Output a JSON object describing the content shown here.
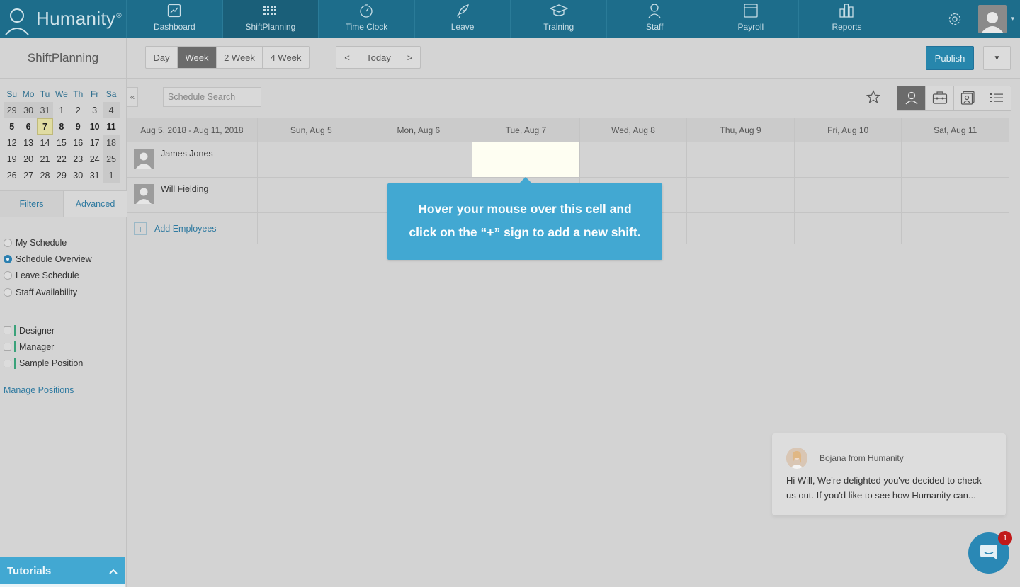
{
  "brand": {
    "name": "Humanity",
    "reg": "®"
  },
  "nav": [
    {
      "label": "Dashboard",
      "icon": "dashboard-icon"
    },
    {
      "label": "ShiftPlanning",
      "icon": "calendar-grid-icon"
    },
    {
      "label": "Time Clock",
      "icon": "stopwatch-icon"
    },
    {
      "label": "Leave",
      "icon": "rocket-icon"
    },
    {
      "label": "Training",
      "icon": "graduation-cap-icon"
    },
    {
      "label": "Staff",
      "icon": "person-icon"
    },
    {
      "label": "Payroll",
      "icon": "payroll-icon"
    },
    {
      "label": "Reports",
      "icon": "bar-chart-icon"
    }
  ],
  "toolbar": {
    "title": "ShiftPlanning",
    "ranges": [
      "Day",
      "Week",
      "2 Week",
      "4 Week"
    ],
    "active_range": "Week",
    "prev": "<",
    "today": "Today",
    "next": ">",
    "publish": "Publish"
  },
  "mini_calendar": {
    "headers": [
      "Su",
      "Mo",
      "Tu",
      "We",
      "Th",
      "Fr",
      "Sa"
    ],
    "weeks": [
      [
        "29",
        "30",
        "31",
        "1",
        "2",
        "3",
        "4"
      ],
      [
        "5",
        "6",
        "7",
        "8",
        "9",
        "10",
        "11"
      ],
      [
        "12",
        "13",
        "14",
        "15",
        "16",
        "17",
        "18"
      ],
      [
        "19",
        "20",
        "21",
        "22",
        "23",
        "24",
        "25"
      ],
      [
        "26",
        "27",
        "28",
        "29",
        "30",
        "31",
        "1"
      ]
    ],
    "today": "7"
  },
  "sidebar": {
    "tabs": [
      "Filters",
      "Advanced"
    ],
    "views": [
      "My Schedule",
      "Schedule Overview",
      "Leave Schedule",
      "Staff Availability"
    ],
    "selected_view": "Schedule Overview",
    "positions": [
      "Designer",
      "Manager",
      "Sample Position"
    ],
    "manage_positions": "Manage Positions",
    "tutorials": "Tutorials"
  },
  "schedule": {
    "search_placeholder": "Schedule Search",
    "range_label": "Aug 5, 2018 - Aug 11, 2018",
    "days": [
      "Sun, Aug 5",
      "Mon, Aug 6",
      "Tue, Aug 7",
      "Wed, Aug 8",
      "Thu, Aug 9",
      "Fri, Aug 10",
      "Sat, Aug 11"
    ],
    "employees": [
      "James Jones",
      "Will Fielding"
    ],
    "add_employees": "Add Employees"
  },
  "tooltip": {
    "line1": "Hover your mouse over this cell and",
    "line2": "click on the “+” sign to add a new shift."
  },
  "chat": {
    "from": "Bojana from Humanity",
    "line1": "Hi Will, We're delighted you've decided to check",
    "line2": "us out. If you'd like to see how Humanity can...",
    "badge": "1"
  },
  "colors": {
    "nav_bg": "#1d6d8b",
    "accent": "#42a8d2",
    "publish": "#2786ac",
    "badge": "#c21a1a"
  }
}
